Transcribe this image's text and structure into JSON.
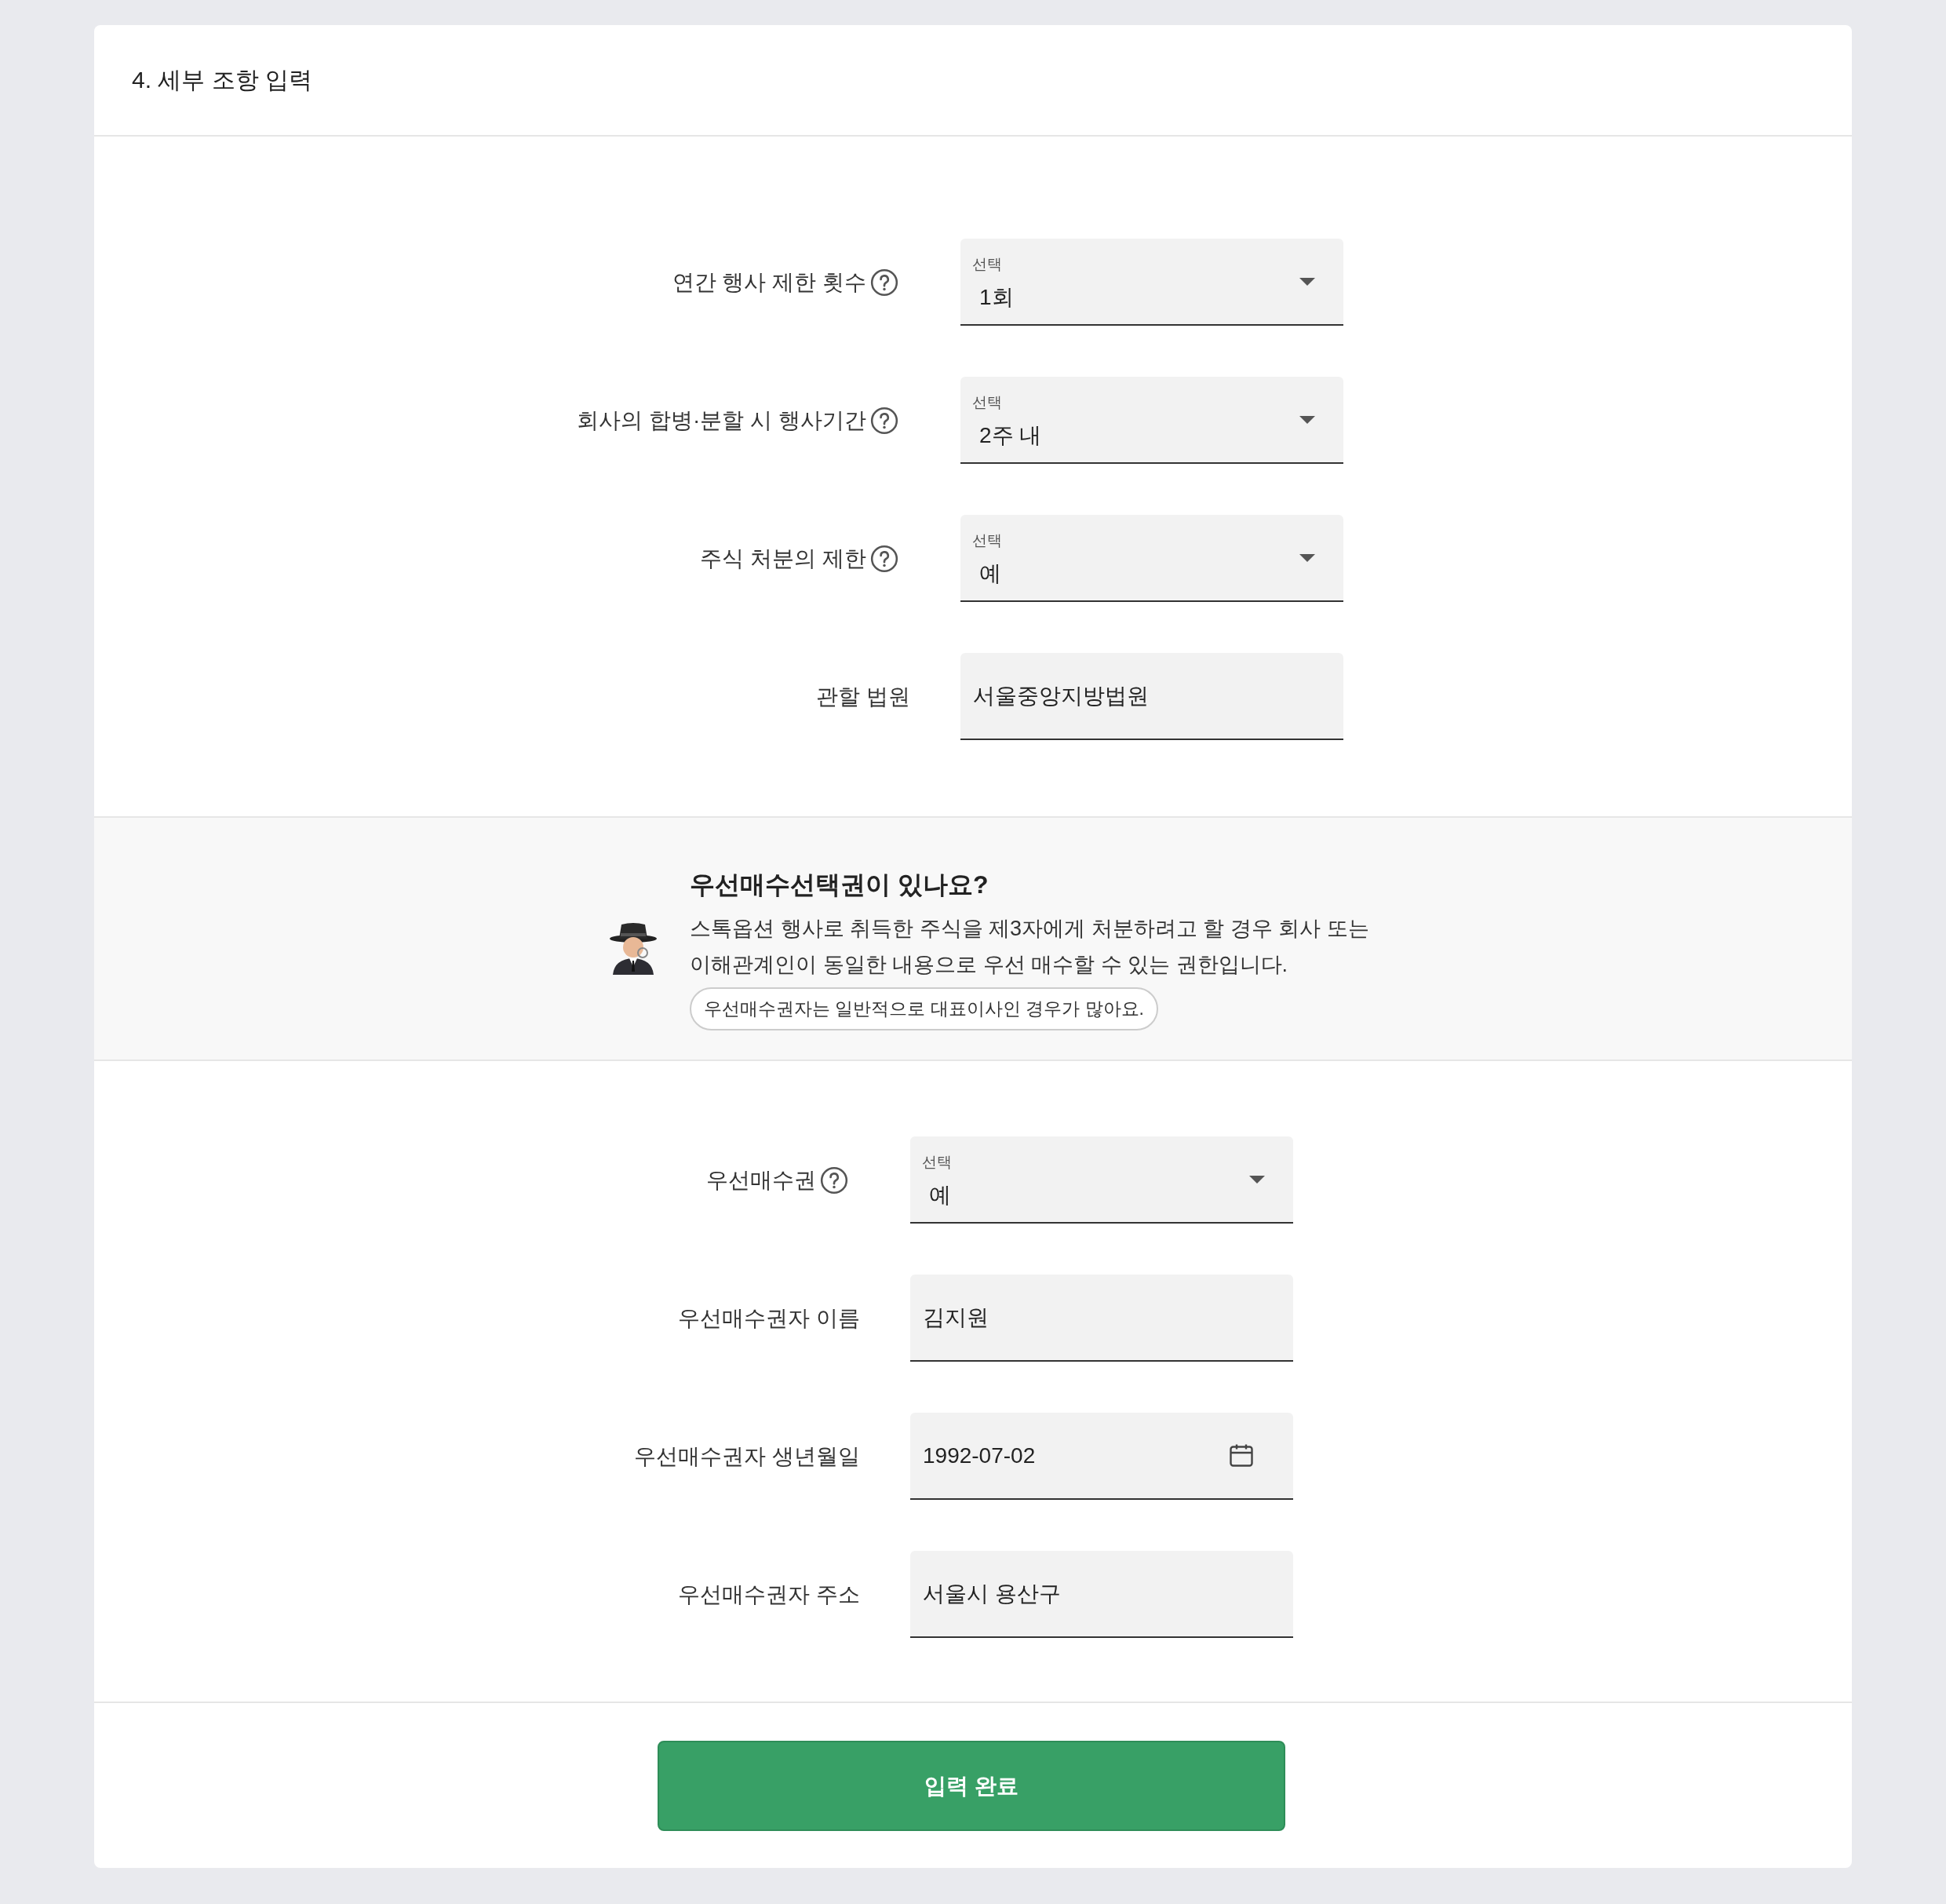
{
  "header": {
    "title": "4. 세부 조항 입력"
  },
  "terms": {
    "fields": [
      {
        "label": "연간 행사 제한 횟수",
        "help": true,
        "kind": "select",
        "placeholder": "선택",
        "value": "1회"
      },
      {
        "label": "회사의 합병·분할 시 행사기간",
        "help": true,
        "kind": "select",
        "placeholder": "선택",
        "value": "2주 내"
      },
      {
        "label": "주식 처분의 제한",
        "help": true,
        "kind": "select",
        "placeholder": "선택",
        "value": "예"
      },
      {
        "label": "관할 법원",
        "help": false,
        "kind": "text",
        "value": "서울중앙지방법원"
      }
    ]
  },
  "info": {
    "title": "우선매수선택권이 있나요?",
    "body": "스톡옵션 행사로 취득한 주식을 제3자에게 처분하려고 할 경우 회사 또는 이해관계인이 동일한 내용으로 우선 매수할 수 있는 권한입니다.",
    "tip": "우선매수권자는 일반적으로 대표이사인 경우가 많아요."
  },
  "holder": {
    "fields": [
      {
        "label": "우선매수권",
        "help": true,
        "kind": "select",
        "placeholder": "선택",
        "value": "예"
      },
      {
        "label": "우선매수권자 이름",
        "help": false,
        "kind": "text",
        "value": "김지원"
      },
      {
        "label": "우선매수권자 생년월일",
        "help": false,
        "kind": "date",
        "value": "1992-07-02"
      },
      {
        "label": "우선매수권자 주소",
        "help": false,
        "kind": "text",
        "value": "서울시 용산구"
      }
    ]
  },
  "submit": {
    "label": "입력 완료"
  }
}
